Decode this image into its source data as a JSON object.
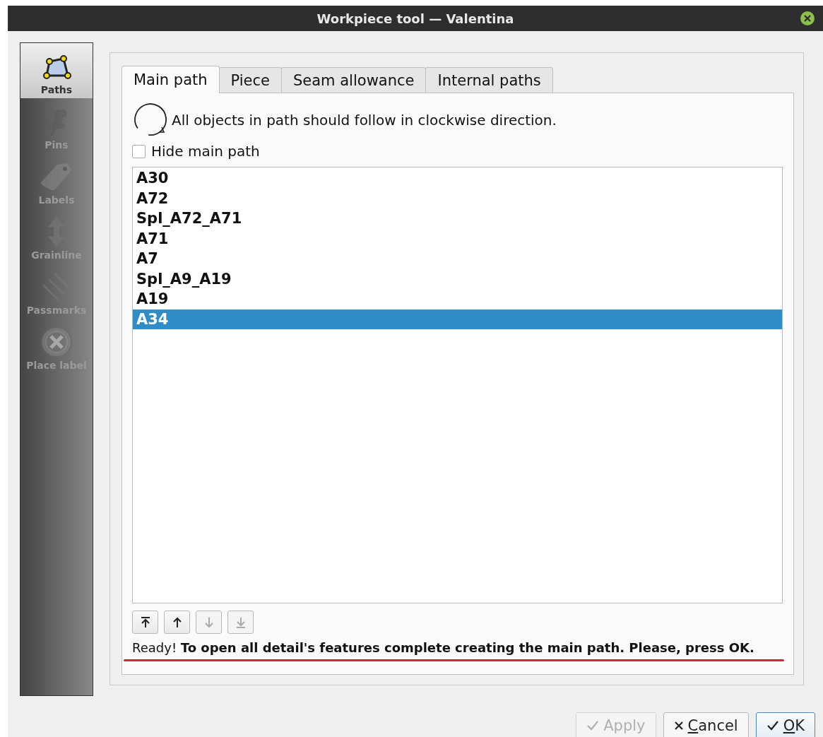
{
  "window": {
    "title": "Workpiece tool — Valentina"
  },
  "sidebar": {
    "items": [
      {
        "label": "Paths",
        "kind": "paths",
        "selected": true,
        "disabled": false
      },
      {
        "label": "Pins",
        "kind": "pins",
        "selected": false,
        "disabled": true
      },
      {
        "label": "Labels",
        "kind": "labels",
        "selected": false,
        "disabled": true
      },
      {
        "label": "Grainline",
        "kind": "grainline",
        "selected": false,
        "disabled": true
      },
      {
        "label": "Passmarks",
        "kind": "passmarks",
        "selected": false,
        "disabled": true
      },
      {
        "label": "Place label",
        "kind": "placelabel",
        "selected": false,
        "disabled": true
      }
    ]
  },
  "tabs": [
    {
      "label": "Main path",
      "selected": true
    },
    {
      "label": "Piece",
      "selected": false
    },
    {
      "label": "Seam allowance",
      "selected": false
    },
    {
      "label": "Internal paths",
      "selected": false
    }
  ],
  "direction_note": "All objects in path should follow in clockwise direction.",
  "hide_main_path": {
    "label": "Hide main path",
    "checked": false
  },
  "path_list": {
    "items": [
      {
        "label": "A30",
        "selected": false
      },
      {
        "label": "A72",
        "selected": false
      },
      {
        "label": "Spl_A72_A71",
        "selected": false
      },
      {
        "label": "A71",
        "selected": false
      },
      {
        "label": "A7",
        "selected": false
      },
      {
        "label": "Spl_A9_A19",
        "selected": false
      },
      {
        "label": "A19",
        "selected": false
      },
      {
        "label": "A34",
        "selected": true
      }
    ]
  },
  "move_buttons": [
    {
      "kind": "top",
      "disabled": false
    },
    {
      "kind": "up",
      "disabled": false
    },
    {
      "kind": "down",
      "disabled": true
    },
    {
      "kind": "bottom",
      "disabled": true
    }
  ],
  "status": "Ready! **To open all detail's features complete creating the main path. Please, press OK.**",
  "buttons": [
    {
      "label": "Apply",
      "kind": "check",
      "disabled": true,
      "default": false,
      "mnemonic": false
    },
    {
      "label": "Cancel",
      "kind": "cross",
      "disabled": false,
      "default": false,
      "mnemonic": true
    },
    {
      "label": "OK",
      "kind": "check",
      "disabled": false,
      "default": true,
      "mnemonic": true
    }
  ]
}
